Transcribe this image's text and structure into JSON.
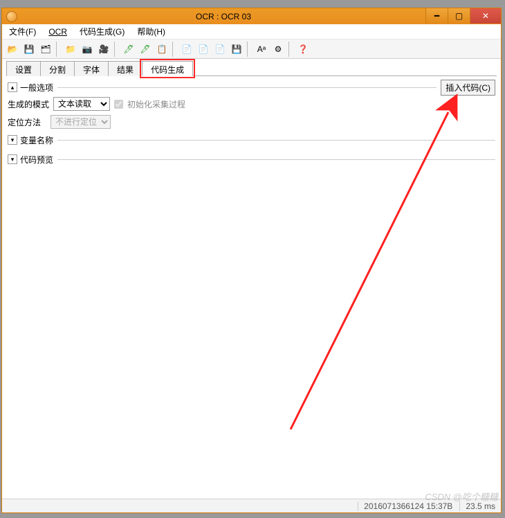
{
  "window": {
    "title": "OCR : OCR 03"
  },
  "menu": {
    "file": "文件(F)",
    "ocr": "OCR",
    "codegen": "代码生成(G)",
    "help": "帮助(H)"
  },
  "toolbar_icons": [
    "open-icon",
    "save-icon",
    "save-all-icon",
    "sep",
    "open-image-icon",
    "camera-icon",
    "record-icon",
    "sep",
    "wand1-icon",
    "wand2-icon",
    "paste-icon",
    "sep",
    "template-icon",
    "doc-a-icon",
    "doc-b-icon",
    "disk-icon",
    "sep",
    "font-icon",
    "gears-icon",
    "sep",
    "help-icon"
  ],
  "tabs": {
    "items": [
      "设置",
      "分割",
      "字体",
      "结果",
      "代码生成"
    ],
    "active_index": 4,
    "highlight_index": 4
  },
  "groups": {
    "general": "一般选项",
    "varnames": "变量名称",
    "preview": "代码预览"
  },
  "buttons": {
    "insert_code": "插入代码(C)"
  },
  "form": {
    "gen_mode_label": "生成的模式",
    "gen_mode_value": "文本读取",
    "gen_mode_options": [
      "文本读取"
    ],
    "init_capture_label": "初始化采集过程",
    "init_capture_checked": true,
    "locate_label": "定位方法",
    "locate_value": "不进行定位",
    "locate_options": [
      "不进行定位"
    ]
  },
  "status": {
    "timestamp": "2016071366124 15:37B",
    "timing": "23.5 ms"
  },
  "watermark": "CSDN @吃个糖糖"
}
